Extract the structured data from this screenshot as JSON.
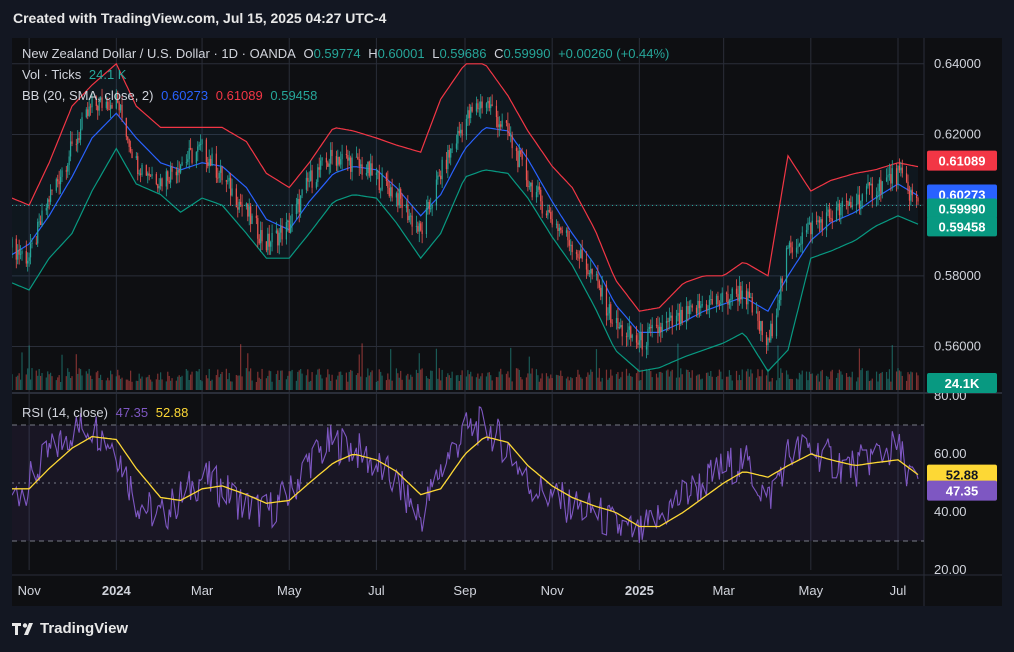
{
  "header": {
    "created": "Created with TradingView.com, Jul 15, 2025 04:27 UTC-4"
  },
  "legend": {
    "title": "New Zealand Dollar / U.S. Dollar · 1D · OANDA",
    "o_label": "O",
    "o": "0.59774",
    "h_label": "H",
    "h": "0.60001",
    "l_label": "L",
    "l": "0.59686",
    "c_label": "C",
    "c": "0.59990",
    "change": "+0.00260 (+0.44%)",
    "vol_label": "Vol · Ticks",
    "vol_value": "24.1 K",
    "bb_label": "BB (20, SMA, close, 2)",
    "bb_basis": "0.60273",
    "bb_upper": "0.61089",
    "bb_lower": "0.59458",
    "rsi_label": "RSI (14, close)",
    "rsi_value": "47.35",
    "rsi_ma": "52.88"
  },
  "footer": {
    "brand": "TradingView"
  },
  "colors": {
    "up": "#26a69a",
    "down": "#ef5350",
    "basis": "#2962ff",
    "upper": "#f23645",
    "lower": "#089981",
    "rsi": "#7e57c2",
    "rsi_ma": "#fdd835",
    "background": "#131722"
  },
  "chart_data": [
    {
      "type": "line",
      "title": "New Zealand Dollar / U.S. Dollar · 1D · OANDA",
      "price_axis_ticks": [
        "0.64000",
        "0.62000",
        "0.60000",
        "0.58000",
        "0.56000"
      ],
      "ylim": [
        0.5477,
        0.6473
      ],
      "x_ticks": [
        "Nov",
        "2024",
        "Mar",
        "May",
        "Jul",
        "Sep",
        "Nov",
        "2025",
        "Mar",
        "May",
        "Jul"
      ],
      "x": [
        "2023-10-20",
        "2023-11-01",
        "2023-11-15",
        "2023-12-01",
        "2023-12-15",
        "2024-01-01",
        "2024-01-15",
        "2024-02-01",
        "2024-02-15",
        "2024-03-01",
        "2024-03-15",
        "2024-04-01",
        "2024-04-15",
        "2024-05-01",
        "2024-05-15",
        "2024-06-01",
        "2024-06-15",
        "2024-07-01",
        "2024-07-15",
        "2024-08-01",
        "2024-08-15",
        "2024-09-01",
        "2024-09-15",
        "2024-10-01",
        "2024-10-15",
        "2024-11-01",
        "2024-11-15",
        "2024-12-01",
        "2024-12-15",
        "2025-01-01",
        "2025-01-15",
        "2025-02-01",
        "2025-02-15",
        "2025-03-01",
        "2025-03-15",
        "2025-04-01",
        "2025-04-15",
        "2025-05-01",
        "2025-05-15",
        "2025-06-01",
        "2025-06-15",
        "2025-07-01",
        "2025-07-15"
      ],
      "series": [
        {
          "name": "close",
          "values": [
            0.588,
            0.585,
            0.602,
            0.616,
            0.628,
            0.63,
            0.612,
            0.607,
            0.612,
            0.616,
            0.608,
            0.598,
            0.589,
            0.594,
            0.607,
            0.614,
            0.612,
            0.608,
            0.603,
            0.592,
            0.609,
            0.624,
            0.63,
            0.62,
            0.607,
            0.596,
            0.589,
            0.579,
            0.566,
            0.561,
            0.565,
            0.568,
            0.572,
            0.573,
            0.576,
            0.56,
            0.587,
            0.594,
            0.597,
            0.601,
            0.605,
            0.609,
            0.5999
          ]
        },
        {
          "name": "0.60273",
          "values": [
            0.586,
            0.589,
            0.597,
            0.608,
            0.619,
            0.626,
            0.619,
            0.612,
            0.61,
            0.612,
            0.611,
            0.605,
            0.596,
            0.593,
            0.601,
            0.609,
            0.611,
            0.61,
            0.605,
            0.597,
            0.603,
            0.616,
            0.622,
            0.621,
            0.613,
            0.601,
            0.592,
            0.583,
            0.572,
            0.564,
            0.564,
            0.567,
            0.57,
            0.572,
            0.574,
            0.57,
            0.58,
            0.59,
            0.595,
            0.598,
            0.602,
            0.606,
            0.6027
          ]
        },
        {
          "name": "0.61089",
          "values": [
            0.602,
            0.6,
            0.612,
            0.628,
            0.634,
            0.64,
            0.628,
            0.622,
            0.622,
            0.622,
            0.622,
            0.618,
            0.609,
            0.605,
            0.612,
            0.622,
            0.621,
            0.619,
            0.617,
            0.615,
            0.63,
            0.64,
            0.64,
            0.631,
            0.621,
            0.611,
            0.605,
            0.593,
            0.579,
            0.57,
            0.571,
            0.578,
            0.58,
            0.58,
            0.584,
            0.58,
            0.614,
            0.604,
            0.607,
            0.609,
            0.61,
            0.612,
            0.6109
          ]
        },
        {
          "name": "0.59458",
          "values": [
            0.578,
            0.576,
            0.585,
            0.592,
            0.604,
            0.616,
            0.606,
            0.603,
            0.598,
            0.602,
            0.6,
            0.592,
            0.585,
            0.585,
            0.592,
            0.601,
            0.603,
            0.602,
            0.595,
            0.585,
            0.592,
            0.608,
            0.61,
            0.609,
            0.602,
            0.591,
            0.583,
            0.571,
            0.559,
            0.553,
            0.554,
            0.557,
            0.559,
            0.561,
            0.564,
            0.553,
            0.559,
            0.585,
            0.587,
            0.59,
            0.594,
            0.597,
            0.5946
          ]
        }
      ]
    },
    {
      "type": "bar",
      "title": "Vol · Ticks",
      "last_value_label": "24.1K",
      "note": "tick volume histogram beneath price"
    },
    {
      "type": "line",
      "title": "RSI (14, close)",
      "ylim": [
        20,
        80
      ],
      "y_ticks": [
        "80.00",
        "60.00",
        "40.00",
        "20.00"
      ],
      "x": [
        "2023-10-20",
        "2023-11-01",
        "2023-11-15",
        "2023-12-01",
        "2023-12-15",
        "2024-01-01",
        "2024-01-15",
        "2024-02-01",
        "2024-02-15",
        "2024-03-01",
        "2024-03-15",
        "2024-04-01",
        "2024-04-15",
        "2024-05-01",
        "2024-05-15",
        "2024-06-01",
        "2024-06-15",
        "2024-07-01",
        "2024-07-15",
        "2024-08-01",
        "2024-08-15",
        "2024-09-01",
        "2024-09-15",
        "2024-10-01",
        "2024-10-15",
        "2024-11-01",
        "2024-11-15",
        "2024-12-01",
        "2024-12-15",
        "2025-01-01",
        "2025-01-15",
        "2025-02-01",
        "2025-02-15",
        "2025-03-01",
        "2025-03-15",
        "2025-04-01",
        "2025-04-15",
        "2025-05-01",
        "2025-05-15",
        "2025-06-01",
        "2025-06-15",
        "2025-07-01",
        "2025-07-15"
      ],
      "series": [
        {
          "name": "47.35",
          "values": [
            45,
            50,
            60,
            68,
            70,
            62,
            44,
            38,
            45,
            52,
            48,
            42,
            40,
            46,
            58,
            64,
            62,
            56,
            50,
            38,
            55,
            68,
            70,
            62,
            50,
            45,
            42,
            40,
            35,
            32,
            38,
            46,
            50,
            55,
            58,
            44,
            60,
            62,
            58,
            55,
            60,
            62,
            47.35
          ]
        },
        {
          "name": "52.88",
          "values": [
            48,
            48,
            55,
            62,
            66,
            65,
            55,
            45,
            44,
            48,
            49,
            46,
            43,
            44,
            50,
            57,
            60,
            58,
            54,
            46,
            48,
            60,
            66,
            64,
            56,
            49,
            45,
            42,
            40,
            35,
            35,
            40,
            45,
            50,
            54,
            52,
            56,
            60,
            58,
            56,
            57,
            58,
            52.88
          ]
        }
      ]
    }
  ]
}
